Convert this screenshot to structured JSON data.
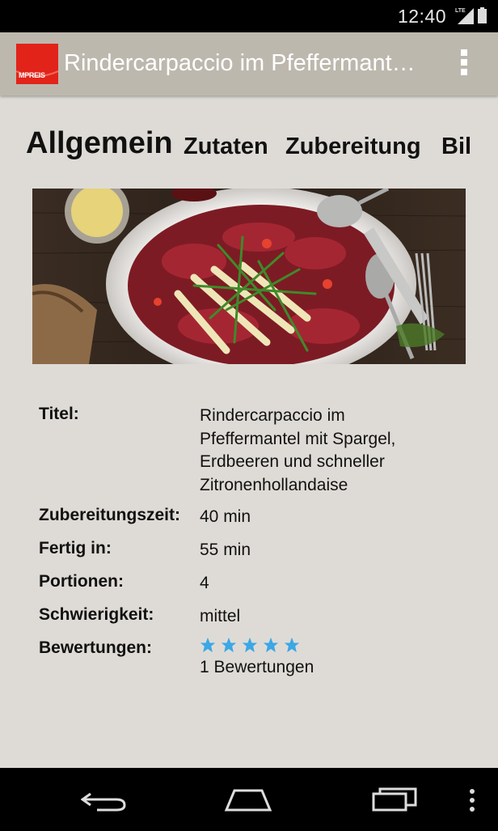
{
  "status_bar": {
    "time": "12:40",
    "network": "LTE"
  },
  "action_bar": {
    "logo_text": "MPREIS",
    "title": "Rindercarpaccio im Pfeffermant…"
  },
  "tabs": [
    "Allgemein",
    "Zutaten",
    "Zubereitung",
    "Bil"
  ],
  "details": {
    "title_label": "Titel:",
    "title_value_lines": [
      "Rindercarpaccio im",
      "Pfeffermantel mit Spargel,",
      "Erdbeeren und schneller",
      "Zitronenhollandaise"
    ],
    "prep_label": "Zubereitungszeit:",
    "prep_value": "40 min",
    "ready_label": "Fertig in:",
    "ready_value": "55 min",
    "portions_label": "Portionen:",
    "portions_value": "4",
    "difficulty_label": "Schwierigkeit:",
    "difficulty_value": "mittel",
    "ratings_label": "Bewertungen:",
    "ratings_stars": 5,
    "ratings_count": "1  Bewertungen"
  },
  "colors": {
    "action_bar": "#bdb8ae",
    "background": "#dedbd6",
    "logo_red": "#e2231a",
    "star_blue": "#3aa7e6"
  },
  "icons": [
    "lte-signal-icon",
    "battery-icon",
    "overflow-menu-icon",
    "back-icon",
    "home-icon",
    "recents-icon",
    "menu-icon"
  ]
}
